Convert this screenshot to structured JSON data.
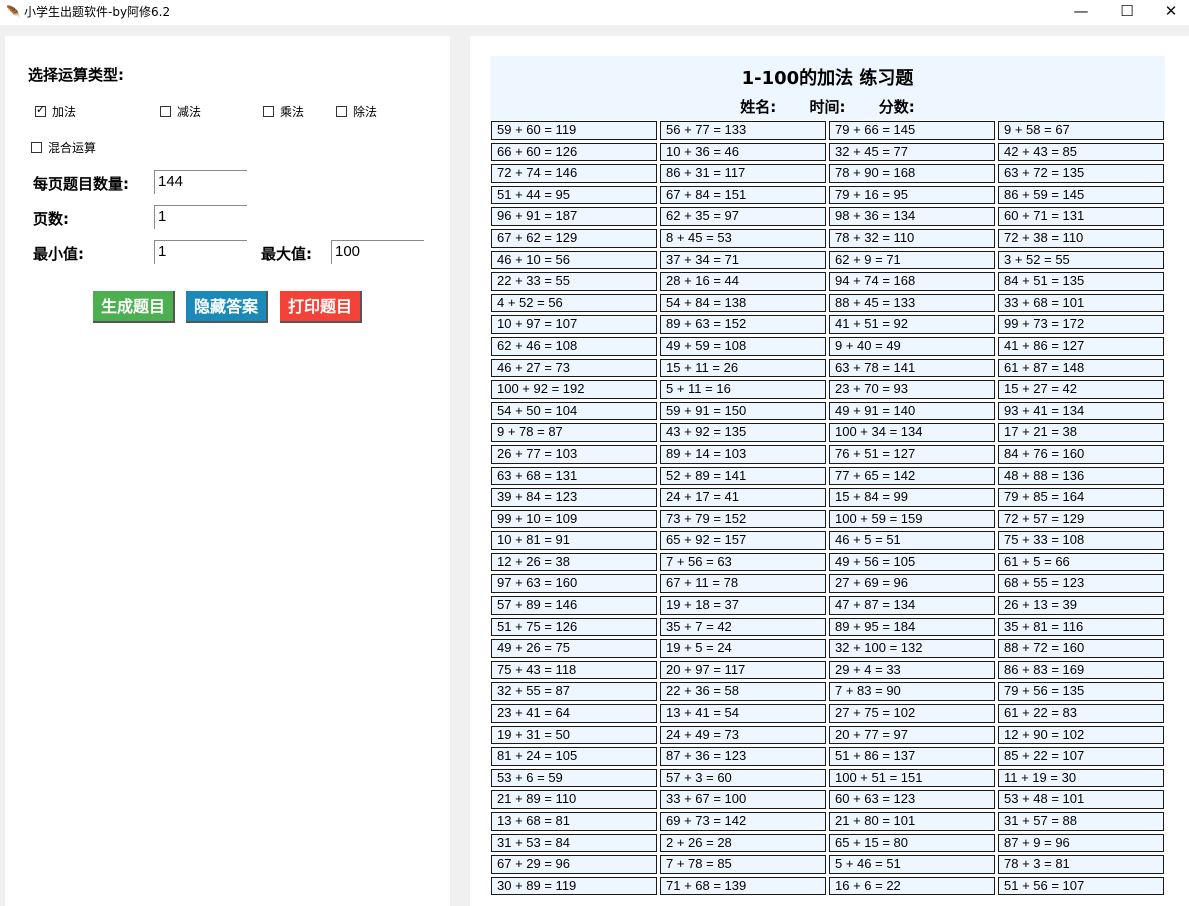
{
  "window": {
    "title": "小学生出题软件-by阿修6.2",
    "buttons": {
      "minimize": "—",
      "maximize": "☐",
      "close": "✕"
    }
  },
  "left": {
    "op_type_label": "选择运算类型:",
    "options": [
      {
        "label": "加法",
        "checked": true
      },
      {
        "label": "减法",
        "checked": false
      },
      {
        "label": "乘法",
        "checked": false
      },
      {
        "label": "除法",
        "checked": false
      }
    ],
    "mixed": {
      "label": "混合运算",
      "checked": false
    },
    "per_page_label": "每页题目数量:",
    "per_page_value": "144",
    "pages_label": "页数:",
    "pages_value": "1",
    "min_label": "最小值:",
    "min_value": "1",
    "max_label": "最大值:",
    "max_value": "100",
    "generate_label": "生成题目",
    "hide_label": "隐藏答案",
    "print_label": "打印题目"
  },
  "paper": {
    "title": "1-100的加法 练习题",
    "name_label": "姓名:",
    "time_label": "时间:",
    "score_label": "分数:"
  },
  "problems": [
    [
      "59 + 60 = 119",
      "56 + 77 = 133",
      "79 + 66 = 145",
      "9 + 58 = 67"
    ],
    [
      "66 + 60 = 126",
      "10 + 36 = 46",
      "32 + 45 = 77",
      "42 + 43 = 85"
    ],
    [
      "72 + 74 = 146",
      "86 + 31 = 117",
      "78 + 90 = 168",
      "63 + 72 = 135"
    ],
    [
      "51 + 44 = 95",
      "67 + 84 = 151",
      "79 + 16 = 95",
      "86 + 59 = 145"
    ],
    [
      "96 + 91 = 187",
      "62 + 35 = 97",
      "98 + 36 = 134",
      "60 + 71 = 131"
    ],
    [
      "67 + 62 = 129",
      "8 + 45 = 53",
      "78 + 32 = 110",
      "72 + 38 = 110"
    ],
    [
      "46 + 10 = 56",
      "37 + 34 = 71",
      "62 + 9 = 71",
      "3 + 52 = 55"
    ],
    [
      "22 + 33 = 55",
      "28 + 16 = 44",
      "94 + 74 = 168",
      "84 + 51 = 135"
    ],
    [
      "4 + 52 = 56",
      "54 + 84 = 138",
      "88 + 45 = 133",
      "33 + 68 = 101"
    ],
    [
      "10 + 97 = 107",
      "89 + 63 = 152",
      "41 + 51 = 92",
      "99 + 73 = 172"
    ],
    [
      "62 + 46 = 108",
      "49 + 59 = 108",
      "9 + 40 = 49",
      "41 + 86 = 127"
    ],
    [
      "46 + 27 = 73",
      "15 + 11 = 26",
      "63 + 78 = 141",
      "61 + 87 = 148"
    ],
    [
      "100 + 92 = 192",
      "5 + 11 = 16",
      "23 + 70 = 93",
      "15 + 27 = 42"
    ],
    [
      "54 + 50 = 104",
      "59 + 91 = 150",
      "49 + 91 = 140",
      "93 + 41 = 134"
    ],
    [
      "9 + 78 = 87",
      "43 + 92 = 135",
      "100 + 34 = 134",
      "17 + 21 = 38"
    ],
    [
      "26 + 77 = 103",
      "89 + 14 = 103",
      "76 + 51 = 127",
      "84 + 76 = 160"
    ],
    [
      "63 + 68 = 131",
      "52 + 89 = 141",
      "77 + 65 = 142",
      "48 + 88 = 136"
    ],
    [
      "39 + 84 = 123",
      "24 + 17 = 41",
      "15 + 84 = 99",
      "79 + 85 = 164"
    ],
    [
      "99 + 10 = 109",
      "73 + 79 = 152",
      "100 + 59 = 159",
      "72 + 57 = 129"
    ],
    [
      "10 + 81 = 91",
      "65 + 92 = 157",
      "46 + 5 = 51",
      "75 + 33 = 108"
    ],
    [
      "12 + 26 = 38",
      "7 + 56 = 63",
      "49 + 56 = 105",
      "61 + 5 = 66"
    ],
    [
      "97 + 63 = 160",
      "67 + 11 = 78",
      "27 + 69 = 96",
      "68 + 55 = 123"
    ],
    [
      "57 + 89 = 146",
      "19 + 18 = 37",
      "47 + 87 = 134",
      "26 + 13 = 39"
    ],
    [
      "51 + 75 = 126",
      "35 + 7 = 42",
      "89 + 95 = 184",
      "35 + 81 = 116"
    ],
    [
      "49 + 26 = 75",
      "19 + 5 = 24",
      "32 + 100 = 132",
      "88 + 72 = 160"
    ],
    [
      "75 + 43 = 118",
      "20 + 97 = 117",
      "29 + 4 = 33",
      "86 + 83 = 169"
    ],
    [
      "32 + 55 = 87",
      "22 + 36 = 58",
      "7 + 83 = 90",
      "79 + 56 = 135"
    ],
    [
      "23 + 41 = 64",
      "13 + 41 = 54",
      "27 + 75 = 102",
      "61 + 22 = 83"
    ],
    [
      "19 + 31 = 50",
      "24 + 49 = 73",
      "20 + 77 = 97",
      "12 + 90 = 102"
    ],
    [
      "81 + 24 = 105",
      "87 + 36 = 123",
      "51 + 86 = 137",
      "85 + 22 = 107"
    ],
    [
      "53 + 6 = 59",
      "57 + 3 = 60",
      "100 + 51 = 151",
      "11 + 19 = 30"
    ],
    [
      "21 + 89 = 110",
      "33 + 67 = 100",
      "60 + 63 = 123",
      "53 + 48 = 101"
    ],
    [
      "13 + 68 = 81",
      "69 + 73 = 142",
      "21 + 80 = 101",
      "31 + 57 = 88"
    ],
    [
      "31 + 53 = 84",
      "2 + 26 = 28",
      "65 + 15 = 80",
      "87 + 9 = 96"
    ],
    [
      "67 + 29 = 96",
      "7 + 78 = 85",
      "5 + 46 = 51",
      "78 + 3 = 81"
    ],
    [
      "30 + 89 = 119",
      "71 + 68 = 139",
      "16 + 6 = 22",
      "51 + 56 = 107"
    ]
  ]
}
